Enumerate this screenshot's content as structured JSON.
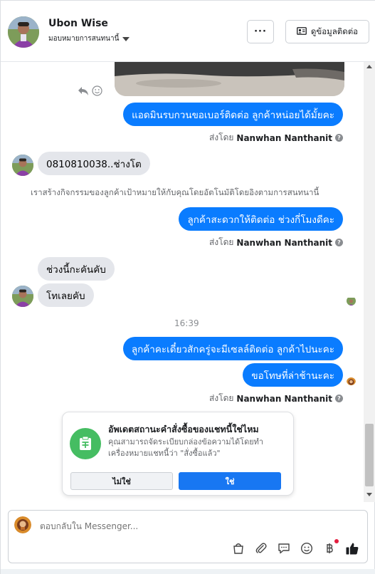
{
  "header": {
    "name": "Ubon Wise",
    "assign_label": "มอบหมายการสนทนานี้",
    "more_label": "···",
    "contact_button_label": "ดูข้อมูลติดต่อ"
  },
  "messages": {
    "out1": "แอดมินรบกวนขอเบอร์ติดต่อ ลูกค้าหน่อยได้มั้ยคะ",
    "sent_prefix": "ส่งโดย",
    "sender_name": "Nanwhan Nanthanit",
    "in1": "0810810038..ช่างโต",
    "system_note": "เราสร้างกิจกรรมของลูกค้าเป้าหมายให้กับคุณโดยอัตโนมัติโดยอิงตามการสนทนานี้",
    "out2": "ลูกค้าสะดวกให้ติดต่อ ช่วงกี่โมงดีคะ",
    "in2": "ช่วงนี้กะคันคับ",
    "in3": "โทเลยคับ",
    "timestamp": "16:39",
    "out3": "ลูกค้าคะเดี๋ยวสักครู่จะมีเซลล์ติดต่อ ลูกค้าไปนะคะ",
    "out4": "ขอโทษที่ล่าช้านะคะ"
  },
  "card": {
    "title": "อัพเดตสถานะคำสั่งซื้อของแชทนี้ใช่ไหม",
    "body": "คุณสามารถจัดระเบียบกล่องข้อความได้โดยทำเครื่องหมายแชทนี้ว่า \"สั่งซื้อแล้ว\"",
    "no_label": "ไม่ใช่",
    "yes_label": "ใช่"
  },
  "composer": {
    "placeholder": "ตอบกลับใน Messenger..."
  },
  "colors": {
    "outgoing_bubble": "#0a7cff",
    "incoming_bubble": "#e4e6eb",
    "primary_button": "#1877f2",
    "card_icon": "#45bd62"
  },
  "icons": [
    "more-icon",
    "contact-card-icon",
    "reply-icon",
    "smile-icon",
    "order-icon",
    "shop-icon",
    "attach-icon",
    "saved-reply-icon",
    "emoji-icon",
    "baht-icon",
    "like-icon"
  ]
}
